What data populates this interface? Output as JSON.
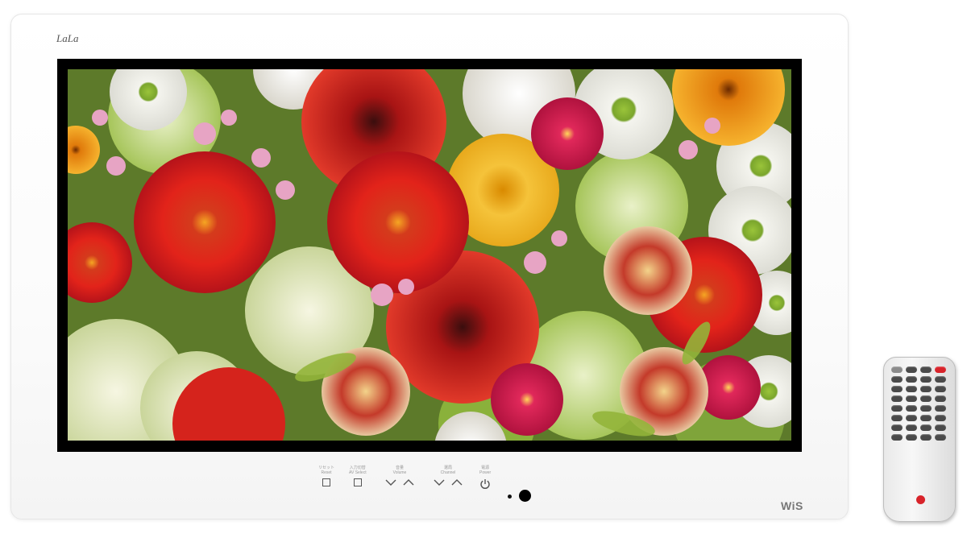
{
  "tv": {
    "brand_top": "LaLa",
    "brand_bottom": "WiS",
    "screen_image": "flower-bouquet-photo"
  },
  "controls": [
    {
      "label_jp": "リセット",
      "label_en": "Reset",
      "keys": [
        "square"
      ]
    },
    {
      "label_jp": "入力切替",
      "label_en": "AV Select",
      "keys": [
        "square"
      ]
    },
    {
      "label_jp": "音量",
      "label_en": "Volume",
      "keys": [
        "chevron-down",
        "chevron-up"
      ]
    },
    {
      "label_jp": "選局",
      "label_en": "Channel",
      "keys": [
        "chevron-down",
        "chevron-up"
      ]
    },
    {
      "label_jp": "電源",
      "label_en": "Power",
      "keys": [
        "power"
      ]
    }
  ],
  "remote": {
    "icon": "remote-control-icon"
  },
  "colors": {
    "body": "#ffffff",
    "bezel": "#000000",
    "remote_accent": "#d8232a"
  }
}
